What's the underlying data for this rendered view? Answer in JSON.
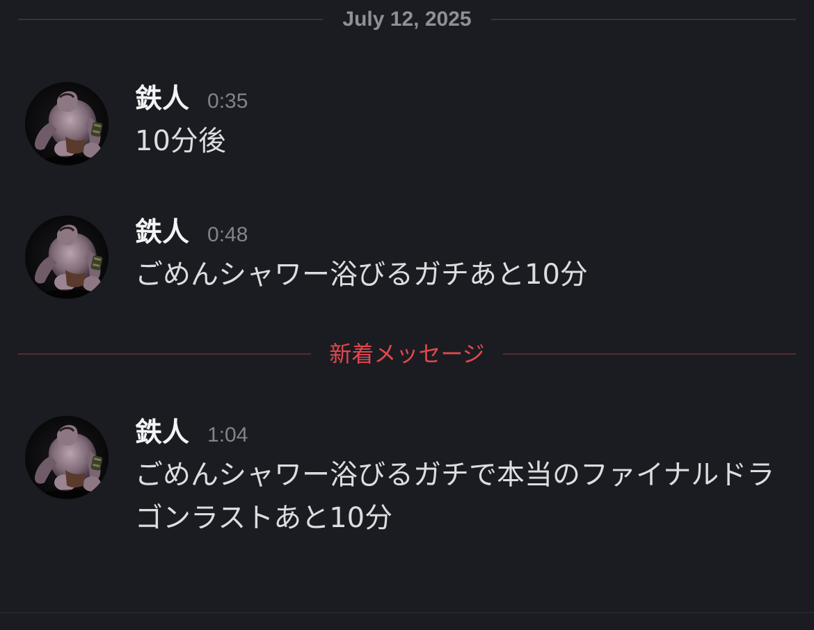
{
  "date_divider": "July 12, 2025",
  "new_messages_label": "新着メッセージ",
  "messages": [
    {
      "author": "鉄人",
      "time": "0:35",
      "text": "10分後",
      "avatar_icon": "muscular-creature-avatar"
    },
    {
      "author": "鉄人",
      "time": "0:48",
      "text": "ごめんシャワー浴びるガチあと10分",
      "avatar_icon": "muscular-creature-avatar"
    },
    {
      "author": "鉄人",
      "time": "1:04",
      "text": "ごめんシャワー浴びるガチで本当のファイナルドラゴンラストあと10分",
      "avatar_icon": "muscular-creature-avatar"
    }
  ],
  "colors": {
    "background": "#1b1c21",
    "divider": "#33353c",
    "new_divider_line": "#5a2b2f",
    "new_divider_text": "#e0484d",
    "username": "#f2f3f5",
    "timestamp": "#80848e",
    "message_text": "#dcdde1"
  }
}
